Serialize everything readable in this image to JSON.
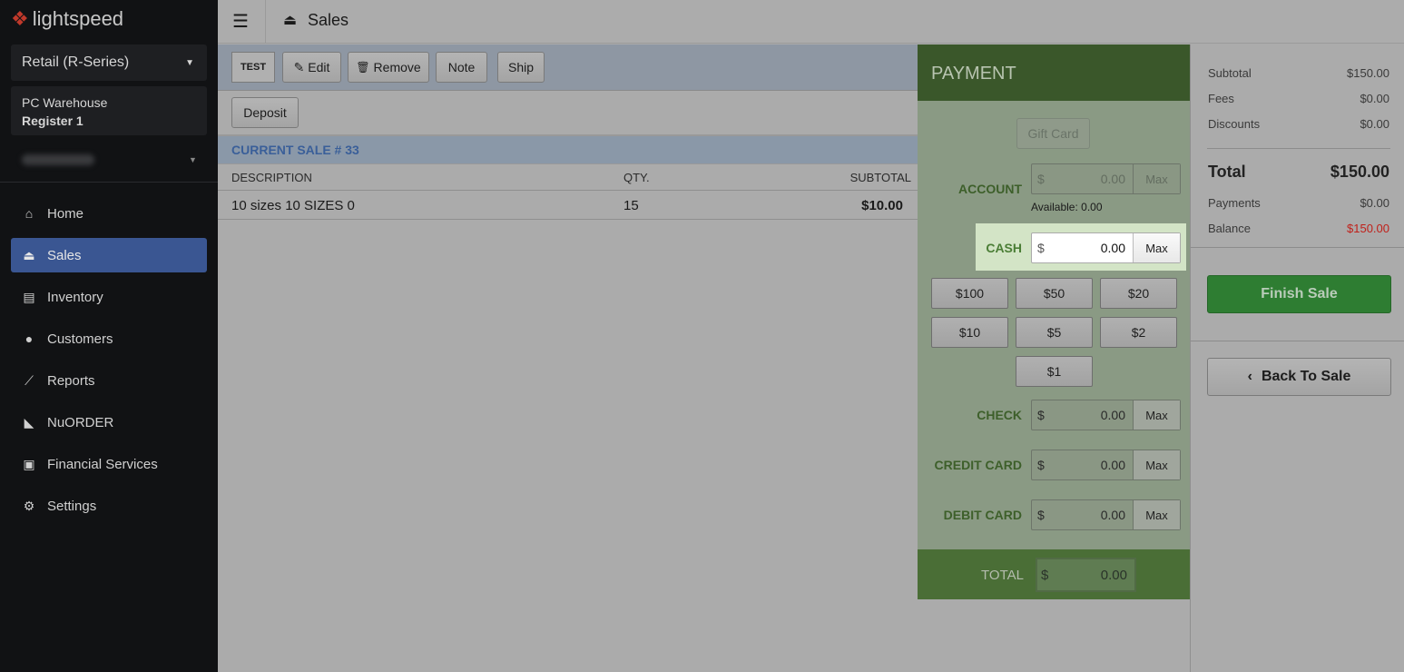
{
  "sidebar": {
    "brand": "lightspeed",
    "product": "Retail (R-Series)",
    "location": "PC Warehouse",
    "register": "Register 1",
    "items": [
      {
        "label": "Home",
        "icon": "home-icon"
      },
      {
        "label": "Sales",
        "icon": "register-icon",
        "active": true
      },
      {
        "label": "Inventory",
        "icon": "inventory-icon"
      },
      {
        "label": "Customers",
        "icon": "user-icon"
      },
      {
        "label": "Reports",
        "icon": "chart-icon"
      },
      {
        "label": "NuORDER",
        "icon": "nuorder-icon"
      },
      {
        "label": "Financial Services",
        "icon": "money-icon"
      },
      {
        "label": "Settings",
        "icon": "gear-icon"
      }
    ]
  },
  "header": {
    "title": "Sales"
  },
  "toolbar": {
    "test": "TEST",
    "edit": "Edit",
    "remove": "Remove",
    "note": "Note",
    "ship": "Ship",
    "deposit": "Deposit"
  },
  "sale": {
    "title": "CURRENT SALE # 33",
    "columns": [
      "DESCRIPTION",
      "QTY.",
      "SUBTOTAL"
    ],
    "rows": [
      {
        "description": "10 sizes 10 SIZES 0",
        "qty": "15",
        "subtotal": "$10.00"
      }
    ]
  },
  "payment": {
    "title": "PAYMENT",
    "gift_card": "Gift Card",
    "currency": "$",
    "max": "Max",
    "account": {
      "label": "ACCOUNT",
      "value": "0.00",
      "available": "Available: 0.00"
    },
    "cash": {
      "label": "CASH",
      "value": "0.00"
    },
    "quick": [
      "$100",
      "$50",
      "$20",
      "$10",
      "$5",
      "$2",
      "$1"
    ],
    "check": {
      "label": "CHECK",
      "value": "0.00"
    },
    "credit": {
      "label": "CREDIT CARD",
      "value": "0.00"
    },
    "debit": {
      "label": "DEBIT CARD",
      "value": "0.00"
    },
    "total": {
      "label": "TOTAL",
      "value": "0.00"
    }
  },
  "summary": {
    "subtotal_label": "Subtotal",
    "subtotal": "$150.00",
    "fees_label": "Fees",
    "fees": "$0.00",
    "discounts_label": "Discounts",
    "discounts": "$0.00",
    "total_label": "Total",
    "total": "$150.00",
    "payments_label": "Payments",
    "payments": "$0.00",
    "balance_label": "Balance",
    "balance": "$150.00",
    "finish": "Finish Sale",
    "back": "Back To Sale"
  },
  "colors": {
    "balance": "#c0201a",
    "finish": "#2e7d32",
    "payment_header": "#3a572a",
    "highlight": "#d3e4c6"
  }
}
